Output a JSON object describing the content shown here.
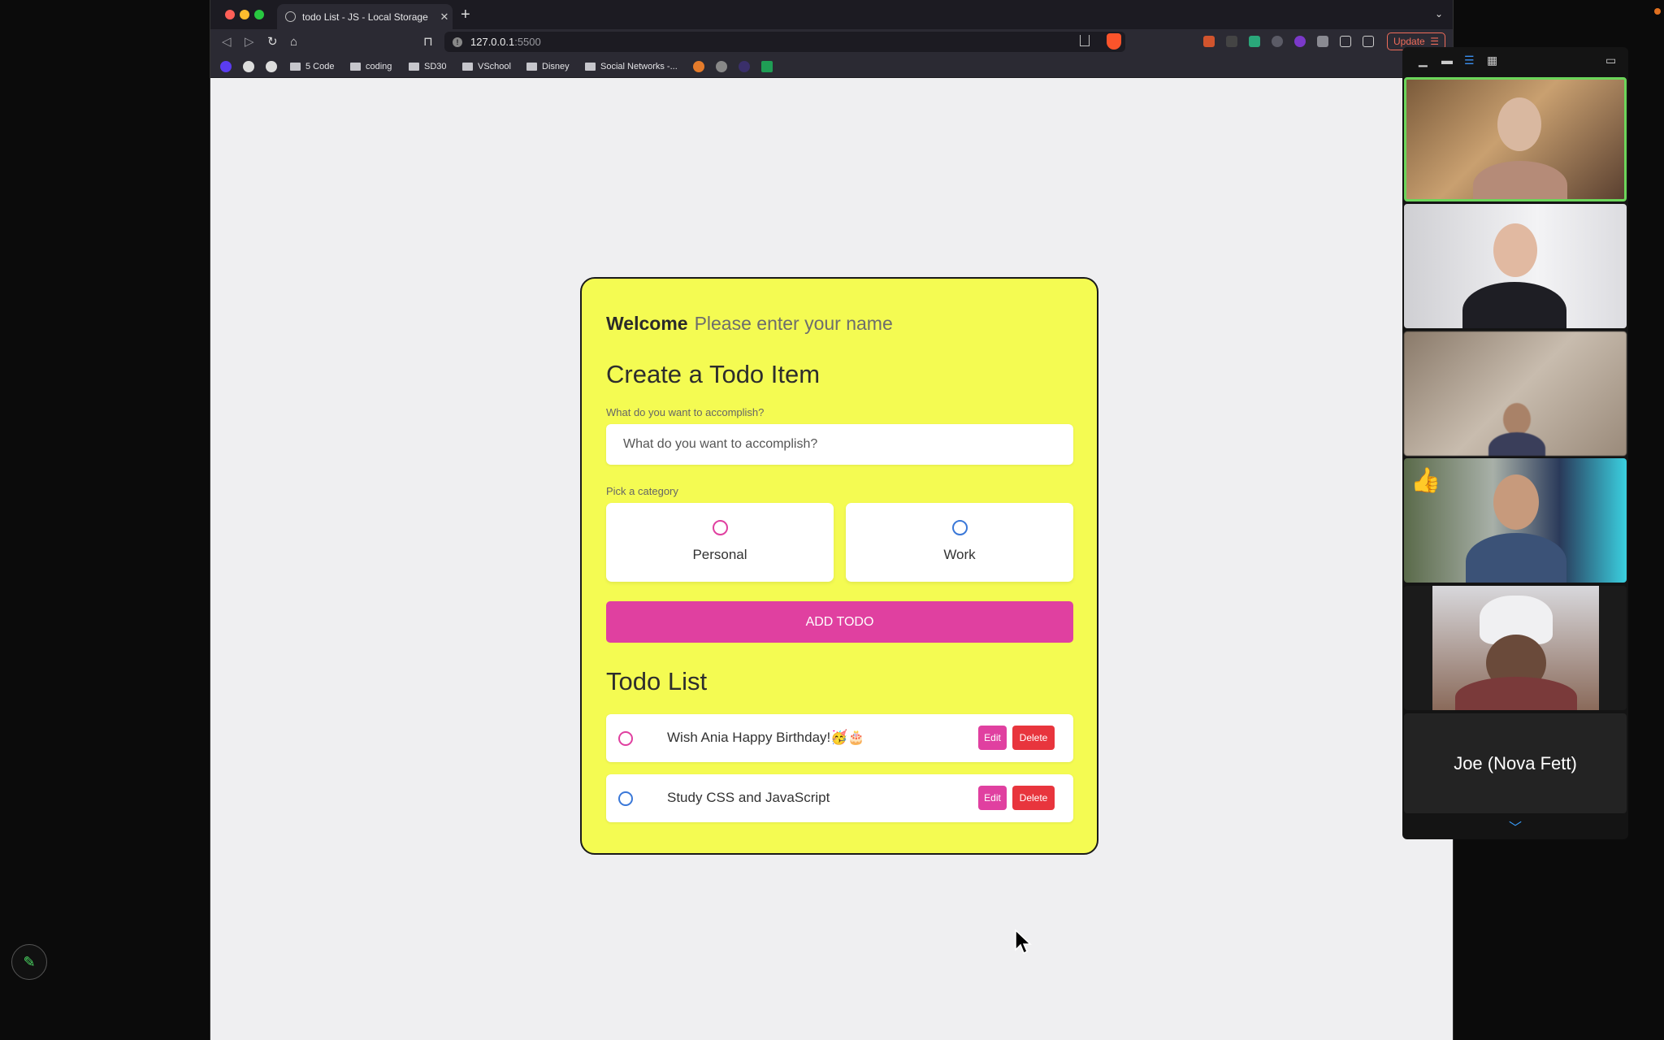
{
  "browser": {
    "tab_title": "todo List - JS - Local Storage",
    "url_host": "127.0.0.1",
    "url_port": ":5500",
    "update_label": "Update",
    "bookmarks": [
      "5 Code",
      "coding",
      "SD30",
      "VSchool",
      "Disney",
      "Social Networks -..."
    ]
  },
  "app": {
    "welcome_label": "Welcome",
    "name_placeholder": "Please enter your name",
    "create_title": "Create a Todo Item",
    "accomplish_label": "What do you want to accomplish?",
    "accomplish_placeholder": "What do you want to accomplish?",
    "category_label": "Pick a category",
    "categories": [
      {
        "label": "Personal",
        "color": "#e040a0"
      },
      {
        "label": "Work",
        "color": "#3a78d8"
      }
    ],
    "add_button": "ADD TODO",
    "list_title": "Todo List",
    "todos": [
      {
        "text": "Wish Ania Happy Birthday!🥳🎂",
        "category_color": "#e040a0",
        "edit_label": "Edit",
        "delete_label": "Delete"
      },
      {
        "text": "Study CSS and JavaScript",
        "category_color": "#3a78d8",
        "edit_label": "Edit",
        "delete_label": "Delete"
      }
    ]
  },
  "video_call": {
    "participant_name": "Joe (Nova Fett)"
  },
  "colors": {
    "card_bg": "#f4fb52",
    "accent_pink": "#e040a0",
    "delete_red": "#e8353d",
    "speaker_border": "#6bd55a"
  }
}
